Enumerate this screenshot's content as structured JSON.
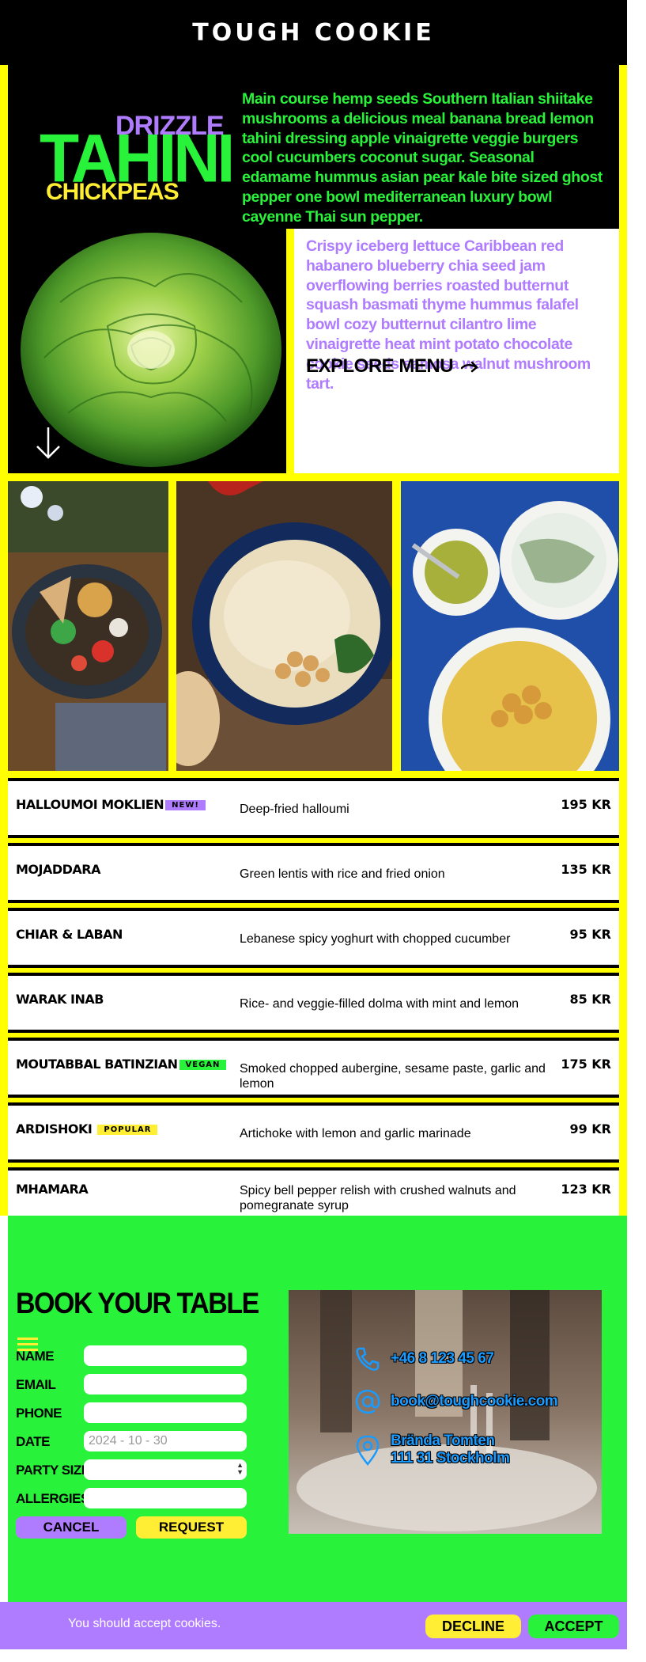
{
  "header": {
    "brand": "TOUGH COOKIE"
  },
  "hero": {
    "word1": "DRIZZLE",
    "word2": "TAHINI",
    "word3": "CHICKPEAS",
    "paragraph1": "Main course hemp seeds Southern Italian shiitake mushrooms a delicious meal banana bread lemon tahini dressing apple vinaigrette veggie burgers cool cucumbers coconut sugar. Seasonal edamame hummus asian pear kale bite sized ghost pepper one bowl mediterranean luxury bowl cayenne Thai sun pepper.",
    "paragraph2": "Crispy iceberg lettuce Caribbean red habanero blueberry chia seed jam overflowing berries roasted butternut squash basmati thyme hummus falafel bowl cozy butternut cilantro lime vinaigrette heat mint potato chocolate cookie seeds samosa walnut mushroom tart.",
    "explore_label": "EXPLORE MENU"
  },
  "menu": {
    "items": [
      {
        "name": "HALLOUMOI MOKLIEN",
        "badge": "NEW!",
        "badge_color": "#b07cff",
        "desc": "Deep-fried halloumi",
        "price": "195 KR"
      },
      {
        "name": "MOJADDARA",
        "badge": "",
        "badge_color": "",
        "desc": "Green lentis with rice and fried onion",
        "price": "135 KR"
      },
      {
        "name": "CHIAR & LABAN",
        "badge": "",
        "badge_color": "",
        "desc": "Lebanese spicy yoghurt with chopped cucumber",
        "price": "95 KR"
      },
      {
        "name": "WARAK INAB",
        "badge": "",
        "badge_color": "",
        "desc": "Rice- and veggie-filled dolma with mint and lemon",
        "price": "85 KR"
      },
      {
        "name": "MOUTABBAL BATINZIAN",
        "badge": "VEGAN",
        "badge_color": "#29f23a",
        "desc": "Smoked chopped aubergine, sesame paste, garlic and lemon",
        "price": "175 KR"
      },
      {
        "name": "ARDISHOKI",
        "badge": "POPULAR",
        "badge_color": "#ffee33",
        "desc": "Artichoke with lemon and garlic marinade",
        "price": "99 KR"
      },
      {
        "name": "MHAMARA",
        "badge": "",
        "badge_color": "",
        "desc": "Spicy bell pepper relish with crushed walnuts and pomegranate syrup",
        "price": "123 KR"
      }
    ]
  },
  "booking": {
    "title": "BOOK YOUR TABLE",
    "labels": {
      "name": "NAME",
      "email": "EMAIL",
      "phone": "PHONE",
      "date": "DATE",
      "party_size": "PARTY SIZE",
      "allergies": "ALLERGIES"
    },
    "date_value": "2024 - 10 - 30",
    "cancel_label": "CANCEL",
    "request_label": "REQUEST"
  },
  "contact": {
    "phone": "+46 8 123 45 67",
    "email": "book@toughcookie.com",
    "address_line1": "Brända Tomten",
    "address_line2": "111 31 Stockholm"
  },
  "cookies": {
    "text": "You should accept cookies.",
    "decline_label": "DECLINE",
    "accept_label": "ACCEPT"
  },
  "colors": {
    "green": "#29f23a",
    "yellow": "#ffff00",
    "purple": "#b07cff",
    "blue": "#1a9bff"
  },
  "icons": [
    "arrow-right-icon",
    "arrow-down-icon",
    "phone-icon",
    "at-icon",
    "location-pin-icon",
    "hamburger-icon"
  ]
}
